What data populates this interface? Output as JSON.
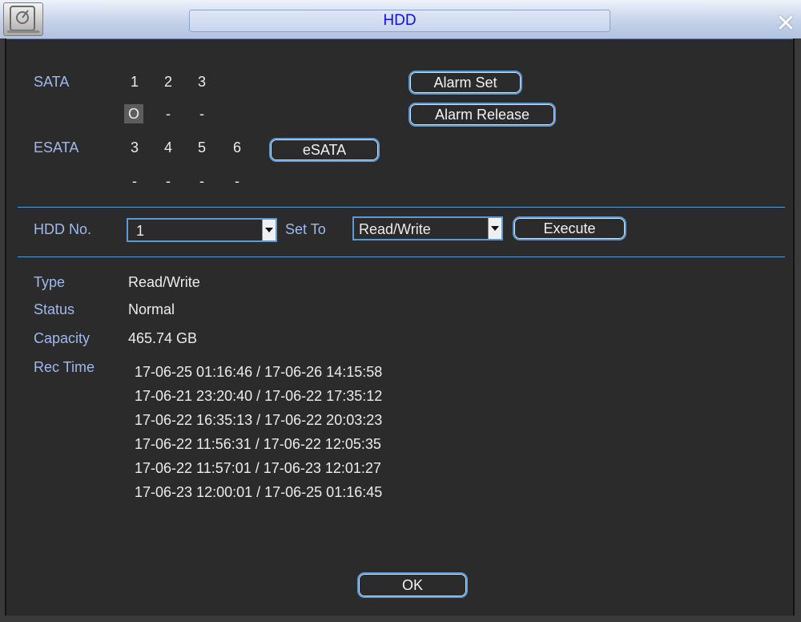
{
  "window": {
    "title": "HDD",
    "close_icon": "close-icon",
    "app_icon": "hdd-icon"
  },
  "sata": {
    "label": "SATA",
    "ports": [
      "1",
      "2",
      "3"
    ],
    "states": [
      "O",
      "-",
      "-"
    ]
  },
  "esata": {
    "label": "ESATA",
    "ports": [
      "3",
      "4",
      "5",
      "6"
    ],
    "states": [
      "-",
      "-",
      "-",
      "-"
    ],
    "button": "eSATA"
  },
  "buttons": {
    "alarm_set": "Alarm Set",
    "alarm_release": "Alarm Release",
    "execute": "Execute",
    "ok": "OK"
  },
  "hdd_select": {
    "label": "HDD No.",
    "value": "1"
  },
  "set_to": {
    "label": "Set To",
    "value": "Read/Write"
  },
  "info": {
    "type_label": "Type",
    "type_value": "Read/Write",
    "status_label": "Status",
    "status_value": "Normal",
    "capacity_label": "Capacity",
    "capacity_value": "465.74 GB",
    "rec_time_label": "Rec Time",
    "rec_times": [
      "17-06-25 01:16:46 / 17-06-26 14:15:58",
      "17-06-21 23:20:40 / 17-06-22 17:35:12",
      "17-06-22 16:35:13 / 17-06-22 20:03:23",
      "17-06-22 11:56:31 / 17-06-22 12:05:35",
      "17-06-22 11:57:01 / 17-06-23 12:01:27",
      "17-06-23 12:00:01 / 17-06-25 01:16:45"
    ]
  },
  "colors": {
    "accent": "#5a9ad6",
    "label": "#9fb9ee",
    "background": "#2b2b2b",
    "title_text": "#1010e0"
  }
}
